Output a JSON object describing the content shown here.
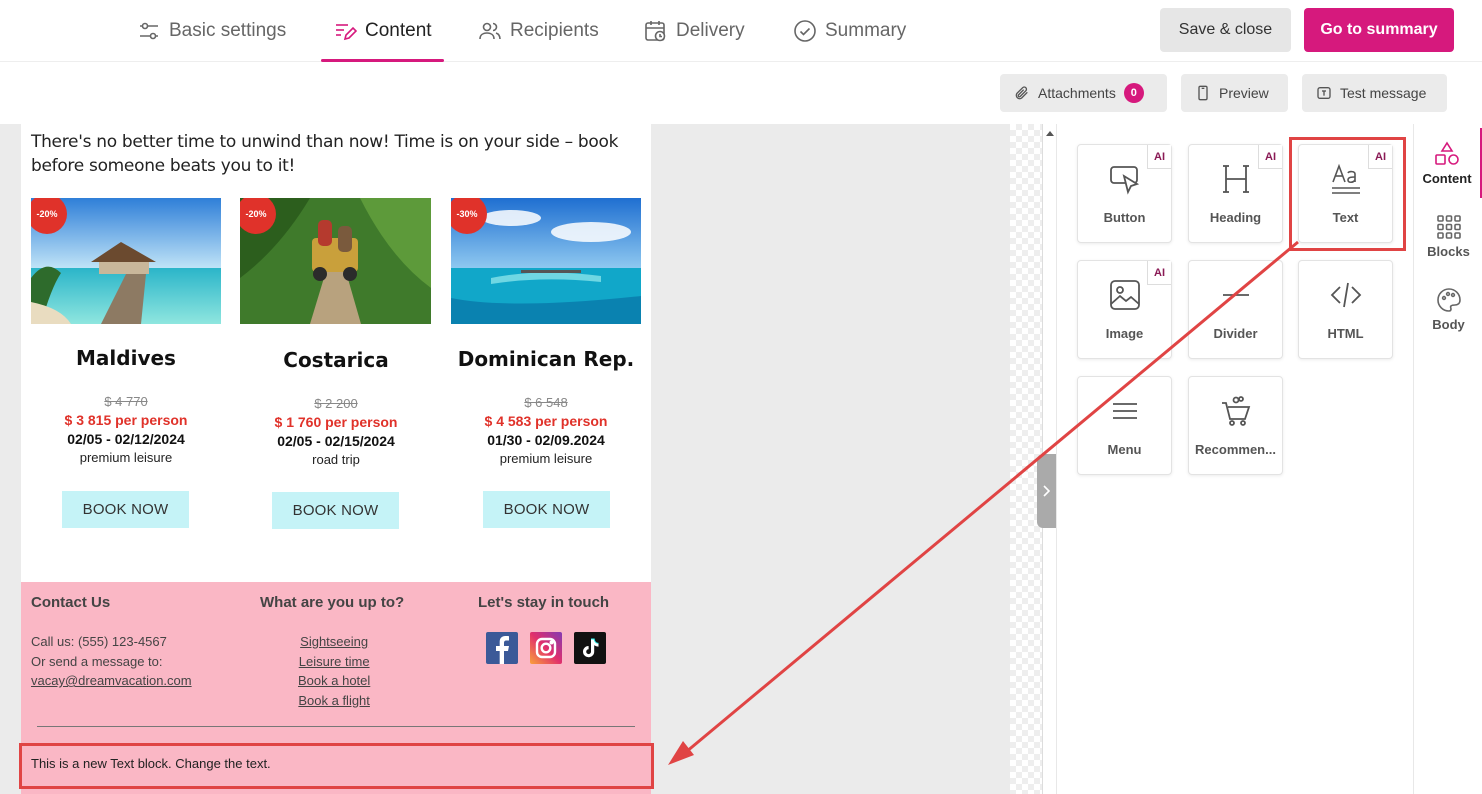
{
  "tabs": [
    {
      "label": "Basic settings",
      "icon": "sliders-icon"
    },
    {
      "label": "Content",
      "icon": "edit-lines-icon",
      "active": true
    },
    {
      "label": "Recipients",
      "icon": "people-icon"
    },
    {
      "label": "Delivery",
      "icon": "calendar-clock-icon"
    },
    {
      "label": "Summary",
      "icon": "check-circle-icon"
    }
  ],
  "actions": {
    "save_close": "Save & close",
    "go_summary": "Go to summary"
  },
  "toolbar": {
    "attachments": "Attachments",
    "attachments_count": "0",
    "preview": "Preview",
    "test_message": "Test message"
  },
  "email": {
    "intro": "There's no better time to unwind than now! Time is on your side – book before someone beats you to it!",
    "destinations": [
      {
        "discount": "-20%",
        "name": "Maldives",
        "old_price": "$ 4 770",
        "new_price": "$ 3 815 per person",
        "dates": "02/05 - 02/12/2024",
        "kind": "premium leisure",
        "cta": "BOOK NOW"
      },
      {
        "discount": "-20%",
        "name": "Costarica",
        "old_price": "$ 2 200",
        "new_price": "$ 1 760 per person",
        "dates": "02/05 - 02/15/2024",
        "kind": "road trip",
        "cta": "BOOK NOW"
      },
      {
        "discount": "-30%",
        "name": "Dominican Rep.",
        "old_price": "$ 6 548",
        "new_price": "$ 4 583 per person",
        "dates": "01/30  - 02/09.2024",
        "kind": "premium leisure",
        "cta": "BOOK NOW"
      }
    ],
    "footer": {
      "contact_heading": "Contact Us",
      "contact_phone": "Call us: (555) 123-4567",
      "contact_msg": "Or send a message to:",
      "contact_email": "vacay@dreamvacation.com",
      "upto_heading": "What are you up to?",
      "links": [
        "Sightseeing",
        "Leisure time",
        "Book a hotel",
        "Book a flight"
      ],
      "touch_heading": "Let's stay in touch"
    },
    "new_text_block": "This is a new Text block. Change the text."
  },
  "content_tiles": [
    {
      "label": "Button",
      "icon": "cursor-button-icon",
      "ai": "AI"
    },
    {
      "label": "Heading",
      "icon": "heading-icon",
      "ai": "AI"
    },
    {
      "label": "Text",
      "icon": "text-icon",
      "ai": "AI"
    },
    {
      "label": "Image",
      "icon": "image-icon",
      "ai": "AI"
    },
    {
      "label": "Divider",
      "icon": "divider-icon"
    },
    {
      "label": "HTML",
      "icon": "code-icon"
    },
    {
      "label": "Menu",
      "icon": "menu-icon"
    },
    {
      "label": "Recommen...",
      "icon": "basket-icon"
    }
  ],
  "rail": [
    {
      "label": "Content",
      "icon": "shapes-icon",
      "active": true
    },
    {
      "label": "Blocks",
      "icon": "grid-icon"
    },
    {
      "label": "Body",
      "icon": "palette-icon"
    }
  ],
  "colors": {
    "accent": "#d6197d",
    "annotation": "#e04444",
    "footer_bg": "#fab7c5",
    "cta_bg": "#c5f3f7",
    "price_red": "#e0322a"
  }
}
